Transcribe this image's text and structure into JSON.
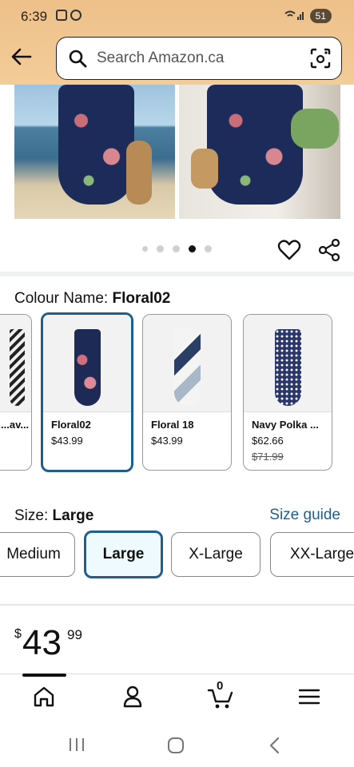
{
  "status_bar": {
    "time": "6:39",
    "battery": "51"
  },
  "search": {
    "placeholder": "Search Amazon.ca"
  },
  "gallery": {
    "dots": 5,
    "active_index": 3
  },
  "colour": {
    "label": "Colour Name:",
    "selected": "Floral02",
    "options": [
      {
        "name": "...av...",
        "price": "",
        "was": ""
      },
      {
        "name": "Floral02",
        "price": "$43.99",
        "was": ""
      },
      {
        "name": "Floral 18",
        "price": "$43.99",
        "was": ""
      },
      {
        "name": "Navy Polka ...",
        "price": "$62.66",
        "was": "$71.99"
      }
    ]
  },
  "size": {
    "label": "Size:",
    "selected": "Large",
    "guide": "Size guide",
    "options": [
      "Medium",
      "Large",
      "X-Large",
      "XX-Large"
    ]
  },
  "price": {
    "currency": "$",
    "whole": "43",
    "fraction": "99"
  },
  "bottom_nav": {
    "cart_count": "0"
  },
  "icons": [
    "back-arrow-icon",
    "search-icon",
    "camera-scan-icon",
    "heart-icon",
    "share-icon",
    "home-icon",
    "account-icon",
    "cart-icon",
    "menu-icon"
  ]
}
